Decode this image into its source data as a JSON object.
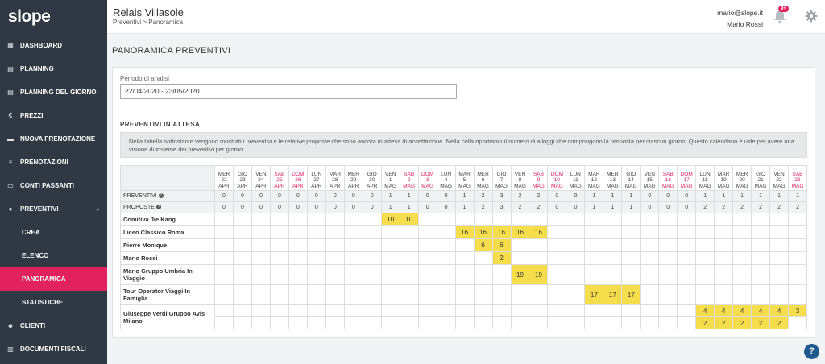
{
  "app": {
    "logo": "slope"
  },
  "sidebar": {
    "items": [
      {
        "label": "DASHBOARD",
        "icon": "dashboard-icon",
        "glyph": "▦",
        "sub": false,
        "active": false
      },
      {
        "label": "PLANNING",
        "icon": "calendar-icon",
        "glyph": "▤",
        "sub": false,
        "active": false
      },
      {
        "label": "PLANNING DEL GIORNO",
        "icon": "calendar-day-icon",
        "glyph": "▤",
        "sub": false,
        "active": false
      },
      {
        "label": "PREZZI",
        "icon": "euro-icon",
        "glyph": "€",
        "sub": false,
        "active": false
      },
      {
        "label": "NUOVA PRENOTAZIONE",
        "icon": "suitcase-icon",
        "glyph": "▬",
        "sub": false,
        "active": false
      },
      {
        "label": "PRENOTAZIONI",
        "icon": "list-icon",
        "glyph": "≡",
        "sub": false,
        "active": false
      },
      {
        "label": "CONTI PASSANTI",
        "icon": "wallet-icon",
        "glyph": "▭",
        "sub": false,
        "active": false
      },
      {
        "label": "PREVENTIVI",
        "icon": "circle-icon",
        "glyph": "●",
        "sub": false,
        "active": false,
        "expandable": true
      },
      {
        "label": "CREA",
        "sub": true,
        "active": false
      },
      {
        "label": "ELENCO",
        "sub": true,
        "active": false
      },
      {
        "label": "PANORAMICA",
        "sub": true,
        "active": true
      },
      {
        "label": "STATISTICHE",
        "sub": true,
        "active": false
      },
      {
        "label": "CLIENTI",
        "icon": "users-icon",
        "glyph": "☻",
        "sub": false,
        "active": false
      },
      {
        "label": "DOCUMENTI FISCALI",
        "icon": "documents-icon",
        "glyph": "▥",
        "sub": false,
        "active": false
      }
    ]
  },
  "header": {
    "title": "Relais Villasole",
    "breadcrumb": "Preventivi > Panoramica",
    "user_email": "mario@slope.it",
    "user_name": "Mario Rossi",
    "notifications_badge": "9+"
  },
  "page": {
    "title": "PANORAMICA PREVENTIVI",
    "period_label": "Periodo di analisi",
    "period_value": "22/04/2020 - 23/05/2020",
    "section_title": "PREVENTIVI IN ATTESA",
    "info_text": "Nella tabella sottostante vengono mostrati i preventivi e le relative proposte che sono ancora in attesa di accettazione. Nella cella riportiamo il numero di alloggi che compongono la proposta per ciascun giorno. Questo calendario è utile per avere una visione di insieme dei preventivi per giorno."
  },
  "colors": {
    "accent": "#e2225e",
    "sidebar": "#2f3843",
    "highlight": "#f5dd4c"
  },
  "table": {
    "days": [
      {
        "dow": "MER",
        "day": "22",
        "mon": "APR",
        "we": false
      },
      {
        "dow": "GIO",
        "day": "23",
        "mon": "APR",
        "we": false
      },
      {
        "dow": "VEN",
        "day": "24",
        "mon": "APR",
        "we": false
      },
      {
        "dow": "SAB",
        "day": "25",
        "mon": "APR",
        "we": true
      },
      {
        "dow": "DOM",
        "day": "26",
        "mon": "APR",
        "we": true
      },
      {
        "dow": "LUN",
        "day": "27",
        "mon": "APR",
        "we": false
      },
      {
        "dow": "MAR",
        "day": "28",
        "mon": "APR",
        "we": false
      },
      {
        "dow": "MER",
        "day": "29",
        "mon": "APR",
        "we": false
      },
      {
        "dow": "GIO",
        "day": "30",
        "mon": "APR",
        "we": false
      },
      {
        "dow": "VEN",
        "day": "1",
        "mon": "MAG",
        "we": false
      },
      {
        "dow": "SAB",
        "day": "2",
        "mon": "MAG",
        "we": true
      },
      {
        "dow": "DOM",
        "day": "3",
        "mon": "MAG",
        "we": true
      },
      {
        "dow": "LUN",
        "day": "4",
        "mon": "MAG",
        "we": false
      },
      {
        "dow": "MAR",
        "day": "5",
        "mon": "MAG",
        "we": false
      },
      {
        "dow": "MER",
        "day": "6",
        "mon": "MAG",
        "we": false
      },
      {
        "dow": "GIO",
        "day": "7",
        "mon": "MAG",
        "we": false
      },
      {
        "dow": "VEN",
        "day": "8",
        "mon": "MAG",
        "we": false
      },
      {
        "dow": "SAB",
        "day": "9",
        "mon": "MAG",
        "we": true
      },
      {
        "dow": "DOM",
        "day": "10",
        "mon": "MAG",
        "we": true
      },
      {
        "dow": "LUN",
        "day": "11",
        "mon": "MAG",
        "we": false
      },
      {
        "dow": "MAR",
        "day": "12",
        "mon": "MAG",
        "we": false
      },
      {
        "dow": "MER",
        "day": "13",
        "mon": "MAG",
        "we": false
      },
      {
        "dow": "GIO",
        "day": "14",
        "mon": "MAG",
        "we": false
      },
      {
        "dow": "VEN",
        "day": "15",
        "mon": "MAG",
        "we": false
      },
      {
        "dow": "SAB",
        "day": "16",
        "mon": "MAG",
        "we": true
      },
      {
        "dow": "DOM",
        "day": "17",
        "mon": "MAG",
        "we": true
      },
      {
        "dow": "LUN",
        "day": "18",
        "mon": "MAG",
        "we": false
      },
      {
        "dow": "MAR",
        "day": "19",
        "mon": "MAG",
        "we": false
      },
      {
        "dow": "MER",
        "day": "20",
        "mon": "MAG",
        "we": false
      },
      {
        "dow": "GIO",
        "day": "21",
        "mon": "MAG",
        "we": false
      },
      {
        "dow": "VEN",
        "day": "22",
        "mon": "MAG",
        "we": false
      },
      {
        "dow": "SAB",
        "day": "23",
        "mon": "MAG",
        "we": true
      }
    ],
    "counts": [
      {
        "label": "PREVENTIVI",
        "values": [
          "0",
          "0",
          "0",
          "0",
          "0",
          "0",
          "0",
          "0",
          "0",
          "1",
          "1",
          "0",
          "0",
          "1",
          "2",
          "3",
          "2",
          "2",
          "0",
          "0",
          "1",
          "1",
          "1",
          "0",
          "0",
          "0",
          "1",
          "1",
          "1",
          "1",
          "1",
          "1"
        ]
      },
      {
        "label": "PROPOSTE",
        "values": [
          "0",
          "0",
          "0",
          "0",
          "0",
          "0",
          "0",
          "0",
          "0",
          "1",
          "1",
          "0",
          "0",
          "1",
          "2",
          "3",
          "2",
          "2",
          "0",
          "0",
          "1",
          "1",
          "1",
          "0",
          "0",
          "0",
          "2",
          "2",
          "2",
          "2",
          "2",
          "2"
        ]
      }
    ],
    "groups": [
      {
        "name": "Comitiva Jie Kang",
        "rows": [
          [
            "",
            "",
            "",
            "",
            "",
            "",
            "",
            "",
            "",
            "10",
            "10",
            "",
            "",
            "",
            "",
            "",
            "",
            "",
            "",
            "",
            "",
            "",
            "",
            "",
            "",
            "",
            "",
            "",
            "",
            "",
            "",
            ""
          ]
        ]
      },
      {
        "name": "Liceo Classico Roma",
        "rows": [
          [
            "",
            "",
            "",
            "",
            "",
            "",
            "",
            "",
            "",
            "",
            "",
            "",
            "",
            "16",
            "16",
            "16",
            "16",
            "16",
            "",
            "",
            "",
            "",
            "",
            "",
            "",
            "",
            "",
            "",
            "",
            "",
            "",
            ""
          ]
        ]
      },
      {
        "name": "Pierre Monique",
        "rows": [
          [
            "",
            "",
            "",
            "",
            "",
            "",
            "",
            "",
            "",
            "",
            "",
            "",
            "",
            "",
            "6",
            "6",
            "",
            "",
            "",
            "",
            "",
            "",
            "",
            "",
            "",
            "",
            "",
            "",
            "",
            "",
            "",
            ""
          ]
        ]
      },
      {
        "name": "Mario Rossi",
        "rows": [
          [
            "",
            "",
            "",
            "",
            "",
            "",
            "",
            "",
            "",
            "",
            "",
            "",
            "",
            "",
            "",
            "2",
            "",
            "",
            "",
            "",
            "",
            "",
            "",
            "",
            "",
            "",
            "",
            "",
            "",
            "",
            "",
            ""
          ]
        ]
      },
      {
        "name": "Mario Gruppo Umbria In Viaggio",
        "rows": [
          [
            "",
            "",
            "",
            "",
            "",
            "",
            "",
            "",
            "",
            "",
            "",
            "",
            "",
            "",
            "",
            "",
            "19",
            "19",
            "",
            "",
            "",
            "",
            "",
            "",
            "",
            "",
            "",
            "",
            "",
            "",
            "",
            ""
          ]
        ]
      },
      {
        "name": "Tour Operator Viaggi In Famiglia",
        "rows": [
          [
            "",
            "",
            "",
            "",
            "",
            "",
            "",
            "",
            "",
            "",
            "",
            "",
            "",
            "",
            "",
            "",
            "",
            "",
            "",
            "",
            "17",
            "17",
            "17",
            "",
            "",
            "",
            "",
            "",
            "",
            "",
            "",
            ""
          ]
        ]
      },
      {
        "name": "Giuseppe Verdi Gruppo Avis Milano",
        "rows": [
          [
            "",
            "",
            "",
            "",
            "",
            "",
            "",
            "",
            "",
            "",
            "",
            "",
            "",
            "",
            "",
            "",
            "",
            "",
            "",
            "",
            "",
            "",
            "",
            "",
            "",
            "",
            "4",
            "4",
            "4",
            "4",
            "4",
            "3"
          ],
          [
            "",
            "",
            "",
            "",
            "",
            "",
            "",
            "",
            "",
            "",
            "",
            "",
            "",
            "",
            "",
            "",
            "",
            "",
            "",
            "",
            "",
            "",
            "",
            "",
            "",
            "",
            "2",
            "2",
            "2",
            "2",
            "2",
            ""
          ]
        ]
      }
    ]
  }
}
